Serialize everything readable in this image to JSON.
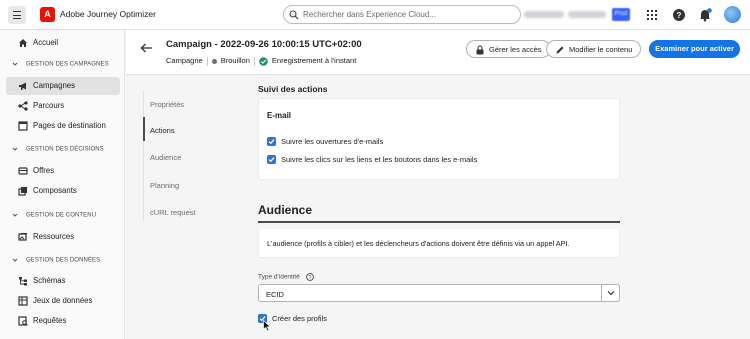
{
  "app": {
    "name": "Adobe Journey Optimizer",
    "search_placeholder": "Rechercher dans Experience Cloud...",
    "env_badge": "Prod"
  },
  "sidebar": {
    "home": "Accueil",
    "sections": [
      {
        "title": "GESTION DES CAMPAGNES",
        "items": [
          "Campagnes",
          "Parcours",
          "Pages de destination"
        ]
      },
      {
        "title": "GESTION DES DÉCISIONS",
        "items": [
          "Offres",
          "Composants"
        ]
      },
      {
        "title": "GESTION DE CONTENU",
        "items": [
          "Ressources"
        ]
      },
      {
        "title": "GESTION DES DONNÉES",
        "items": [
          "Schémas",
          "Jeux de données",
          "Requêtes"
        ]
      }
    ],
    "active_item": "Campagnes"
  },
  "header": {
    "title": "Campaign - 2022-09-26 10:00:15 UTC+02:00",
    "type": "Campagne",
    "status": "Brouillon",
    "save_status": "Enregistrement à l'instant",
    "buttons": {
      "manage_access": "Gérer les accès",
      "edit_content": "Modifier le contenu",
      "review": "Examiner pour activer"
    }
  },
  "tabs": [
    "Propriétés",
    "Actions",
    "Audience",
    "Planning",
    "cURL request"
  ],
  "active_tab": "Actions",
  "tracking": {
    "title": "Suivi des actions",
    "channel": "E-mail",
    "options": [
      {
        "label": "Suivre les ouvertures d'e-mails",
        "checked": true
      },
      {
        "label": "Suivre les clics sur les liens et les boutons dans les e-mails",
        "checked": true
      }
    ]
  },
  "audience": {
    "title": "Audience",
    "info": "L'audience (profils à cibler) et les déclencheurs d'actions doivent être définis via un appel API.",
    "identity_label": "Type d'identité",
    "identity_value": "ECID",
    "create_profiles_label": "Créer des profils",
    "create_profiles_checked": true
  }
}
